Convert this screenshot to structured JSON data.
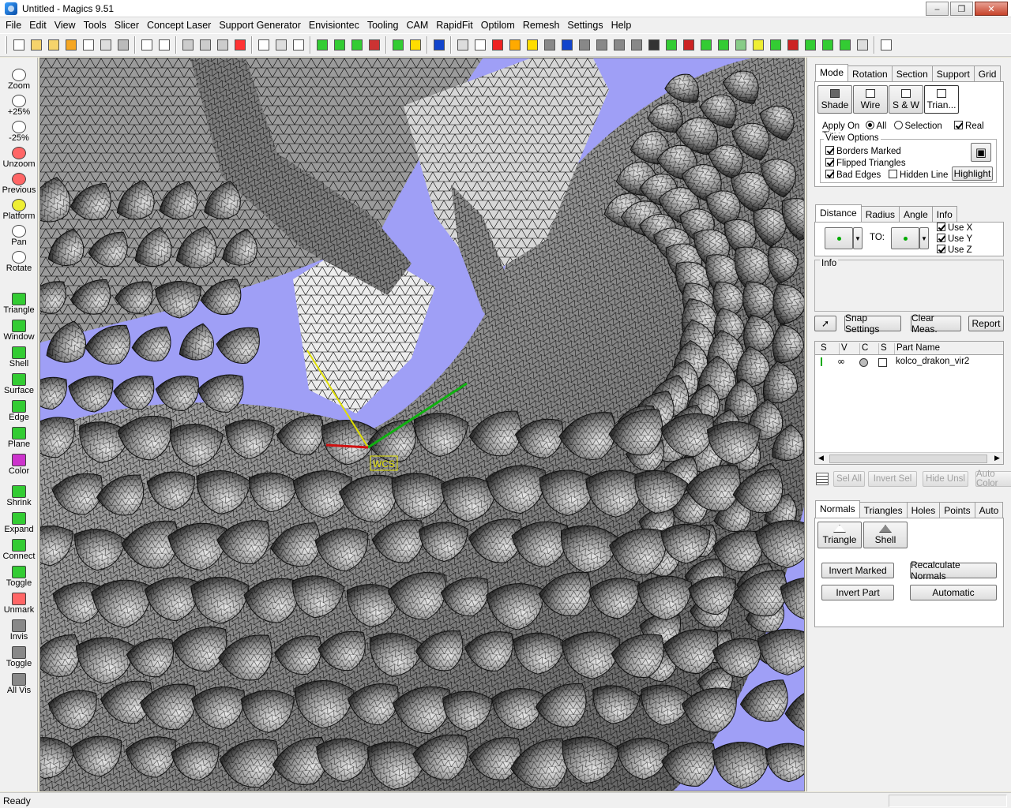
{
  "window": {
    "title": "Untitled - Magics 9.51"
  },
  "menu": [
    "File",
    "Edit",
    "View",
    "Tools",
    "Slicer",
    "Concept Laser",
    "Support Generator",
    "Envisiontec",
    "Tooling",
    "CAM",
    "RapidFit",
    "Optilom",
    "Remesh",
    "Settings",
    "Help"
  ],
  "left_tools": [
    {
      "label": "Zoom",
      "icon": "zoom-icon"
    },
    {
      "label": "+25%",
      "icon": "zoom-in-icon"
    },
    {
      "label": "-25%",
      "icon": "zoom-out-icon"
    },
    {
      "label": "Unzoom",
      "icon": "unzoom-icon"
    },
    {
      "label": "Previous",
      "icon": "previous-view-icon"
    },
    {
      "label": "Platform",
      "icon": "platform-icon"
    },
    {
      "label": "Pan",
      "icon": "pan-icon"
    },
    {
      "label": "Rotate",
      "icon": "rotate-icon"
    },
    {
      "label": "Triangle",
      "icon": "mark-triangle-icon"
    },
    {
      "label": "Window",
      "icon": "mark-window-icon"
    },
    {
      "label": "Shell",
      "icon": "mark-shell-icon"
    },
    {
      "label": "Surface",
      "icon": "mark-surface-icon"
    },
    {
      "label": "Edge",
      "icon": "mark-edge-icon"
    },
    {
      "label": "Plane",
      "icon": "mark-plane-icon"
    },
    {
      "label": "Color",
      "icon": "mark-color-icon"
    },
    {
      "label": "Shrink",
      "icon": "shrink-icon"
    },
    {
      "label": "Expand",
      "icon": "expand-icon"
    },
    {
      "label": "Connect",
      "icon": "connect-icon"
    },
    {
      "label": "Toggle",
      "icon": "toggle-icon"
    },
    {
      "label": "Unmark",
      "icon": "unmark-icon"
    },
    {
      "label": "Invis",
      "icon": "invisible-icon"
    },
    {
      "label": "Toggle",
      "icon": "toggle-visibility-icon"
    },
    {
      "label": "All Vis",
      "icon": "all-visible-icon"
    }
  ],
  "view_panel": {
    "tabs": [
      "Mode",
      "Rotation",
      "Section",
      "Support",
      "Grid"
    ],
    "modes": [
      "Shade",
      "Wire",
      "S & W",
      "Trian..."
    ],
    "apply_on_label": "Apply On",
    "apply_all": "All",
    "apply_selection": "Selection",
    "real_time": "Real Time",
    "view_options_title": "View Options",
    "borders_marked": "Borders Marked",
    "flipped_triangles": "Flipped Triangles",
    "bad_edges": "Bad Edges",
    "hidden_line": "Hidden Line",
    "highlight": "Highlight"
  },
  "measure_panel": {
    "tabs": [
      "Distance",
      "Radius",
      "Angle",
      "Info"
    ],
    "to_label": "TO:",
    "use_x": "Use X",
    "use_y": "Use Y",
    "use_z": "Use Z",
    "info_title": "Info",
    "snap_settings": "Snap Settings",
    "clear_meas": "Clear Meas.",
    "report": "Report"
  },
  "parts_list": {
    "columns": [
      "S",
      "V",
      "C",
      "S",
      "Part Name"
    ],
    "rows": [
      {
        "name": "kolco_drakon_vir2"
      }
    ],
    "buttons": [
      "Sel All",
      "Invert Sel",
      "Hide Unsl",
      "Auto Color"
    ]
  },
  "fix_panel": {
    "tabs": [
      "Normals",
      "Triangles",
      "Holes",
      "Points",
      "Auto"
    ],
    "tools": [
      "Triangle",
      "Shell"
    ],
    "invert_marked": "Invert Marked",
    "recalculate_normals": "Recalculate Normals",
    "invert_part": "Invert Part",
    "automatic": "Automatic"
  },
  "viewport": {
    "wcs_label": "WCS",
    "background": "#9f9ff6",
    "axis_colors": {
      "x": "#d01010",
      "y": "#10b010",
      "z": "#e0e000"
    }
  },
  "status": {
    "text": "Ready"
  }
}
